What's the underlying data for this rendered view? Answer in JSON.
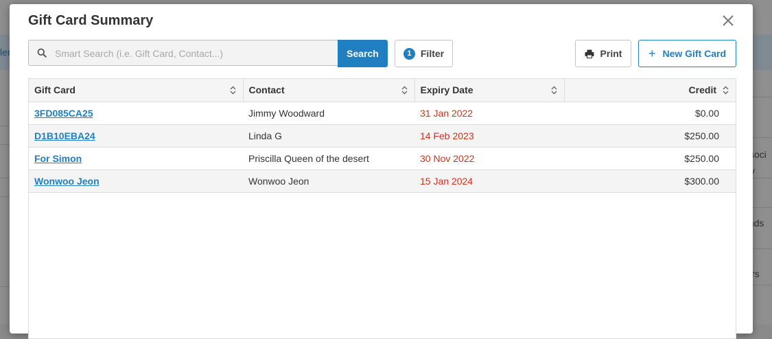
{
  "modal": {
    "title": "Gift Card Summary"
  },
  "search": {
    "placeholder": "Smart Search (i.e. Gift Card, Contact...)",
    "button_label": "Search"
  },
  "filter": {
    "label": "Filter",
    "count": "1"
  },
  "print": {
    "label": "Print"
  },
  "new_gift_card": {
    "label": "New Gift Card"
  },
  "table": {
    "columns": [
      "Gift Card",
      "Contact",
      "Expiry Date",
      "Credit"
    ],
    "rows": [
      {
        "gift_card": "3FD085CA25",
        "contact": "Jimmy Woodward",
        "expiry": "31 Jan 2022",
        "credit": "$0.00"
      },
      {
        "gift_card": "D1B10EBA24",
        "contact": "Linda G",
        "expiry": "14 Feb 2023",
        "credit": "$250.00"
      },
      {
        "gift_card": "For Simon",
        "contact": "Priscilla Queen of the desert",
        "expiry": "30 Nov 2022",
        "credit": "$250.00"
      },
      {
        "gift_card": "Wonwoo Jeon",
        "contact": "Wonwoo Jeon",
        "expiry": "15 Jan 2024",
        "credit": "$300.00"
      }
    ]
  },
  "background": {
    "left_snippet": "len",
    "right_snippets": [
      "ssoci",
      "y",
      "ends",
      "rs"
    ]
  },
  "colors": {
    "accent": "#1f7fc1",
    "expiry_text": "#d2311b",
    "overlay": "#8f8f8f"
  }
}
